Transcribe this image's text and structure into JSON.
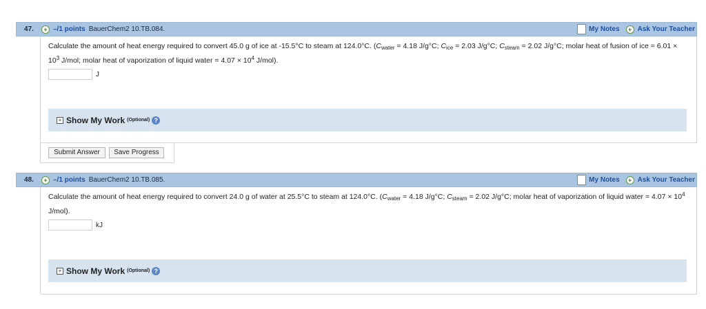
{
  "q47": {
    "number": "47.",
    "points": "–/1 points",
    "id": "BauerChem2 10.TB.084.",
    "my_notes": "My Notes",
    "ask_teacher": "Ask Your Teacher",
    "text_1": "Calculate the amount of heat energy required to convert 45.0 g of ice at -15.5°C to steam at 124.0°C. (",
    "c_water_sym": "C",
    "c_water_sub": "water",
    "c_water_val": " = 4.18 J/g°C; ",
    "c_ice_sym": "C",
    "c_ice_sub": "ice",
    "c_ice_val": " = 2.03 J/g°C; ",
    "c_steam_sym": "C",
    "c_steam_sub": "steam",
    "c_steam_val": " = 2.02 J/g°C; molar heat of fusion of ice = 6.01 × 10",
    "fusion_exp": "3",
    "text_2": " J/mol; molar heat of vaporization of liquid water = 4.07 × 10",
    "vap_exp": "4",
    "text_3": " J/mol).",
    "answer_value": "",
    "unit": "J",
    "show_work": "Show My Work",
    "optional": "(Optional)",
    "help": "?"
  },
  "buttons": {
    "submit": "Submit Answer",
    "save": "Save Progress"
  },
  "q48": {
    "number": "48.",
    "points": "–/1 points",
    "id": "BauerChem2 10.TB.085.",
    "my_notes": "My Notes",
    "ask_teacher": "Ask Your Teacher",
    "text_1": "Calculate the amount of heat energy required to convert 24.0 g of water at 25.5°C to steam at 124.0°C. (",
    "c_water_sym": "C",
    "c_water_sub": "water",
    "c_water_val": " = 4.18 J/g°C; ",
    "c_steam_sym": "C",
    "c_steam_sub": "steam",
    "c_steam_val": " = 2.02 J/g°C; molar heat of vaporization of liquid water = 4.07 × 10",
    "vap_exp": "4",
    "text_2": " J/mol).",
    "answer_value": "",
    "unit": "kJ",
    "show_work": "Show My Work",
    "optional": "(Optional)",
    "help": "?"
  }
}
